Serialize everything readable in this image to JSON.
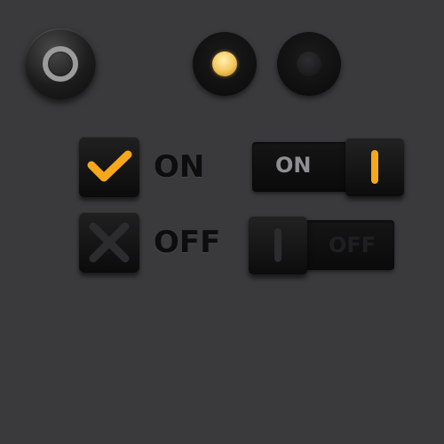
{
  "checkboxes": {
    "on_label": "ON",
    "off_label": "OFF"
  },
  "toggles": {
    "on_text": "ON",
    "off_text": "OFF"
  },
  "colors": {
    "background": "#3a3a3c",
    "accent": "#f5a81c",
    "led_on": "#f3c45a",
    "control_dark": "#0d0d0d"
  },
  "icons": {
    "power": "power-ring-icon",
    "check": "checkmark-icon",
    "cross": "x-icon"
  },
  "states": {
    "led_1_lit": true,
    "led_2_lit": false,
    "checkbox_1_checked": true,
    "checkbox_2_checked": false,
    "toggle_1_on": true,
    "toggle_2_on": false
  }
}
